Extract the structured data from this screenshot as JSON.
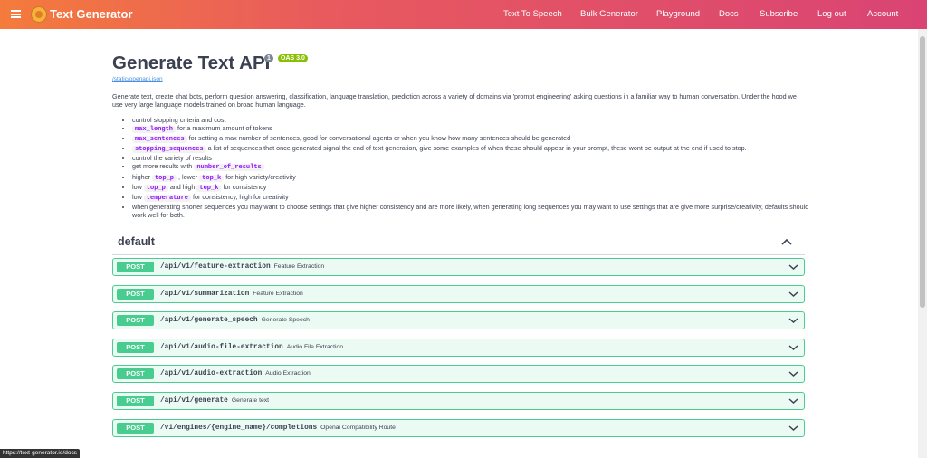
{
  "nav": {
    "brand": "Text Generator",
    "links": [
      "Text To Speech",
      "Bulk Generator",
      "Playground",
      "Docs",
      "Subscribe",
      "Log out",
      "Account"
    ]
  },
  "api": {
    "title": "Generate Text API",
    "version": "1",
    "oas": "OAS 3.0",
    "spec_link": "/static/openapi.json",
    "description": "Generate text, create chat bots, perform question answering, classification, language translation, prediction across a variety of domains via 'prompt engineering' asking questions in a familiar way to human conversation. Under the hood we use very large language models trained on broad human language."
  },
  "features": [
    {
      "pre": "control stopping criteria and cost",
      "code": "",
      "post": ""
    },
    {
      "pre": "",
      "code": "max_length",
      "post": "for a maximum amount of tokens"
    },
    {
      "pre": "",
      "code": "max_sentences",
      "post": "for setting a max number of sentences, good for conversational agents or when you know how many sentences should be generated"
    },
    {
      "pre": "",
      "code": "stopping_sequences",
      "post": "a list of sequences that once generated signal the end of text generation, give some examples of when these should appear in your prompt, these wont be output at the end if used to stop."
    },
    {
      "pre": "control the variety of results",
      "code": "",
      "post": ""
    },
    {
      "pre": "get more results with",
      "code": "number_of_results",
      "post": ""
    },
    {
      "pre": "higher",
      "code": "top_p",
      "post": ", lower",
      "code2": "top_k",
      "post2": "for high variety/creativity"
    },
    {
      "pre": "low",
      "code": "top_p",
      "post": "and high",
      "code2": "top_k",
      "post2": "for consistency"
    },
    {
      "pre": "low",
      "code": "temperature",
      "post": "for consistency, high for creativity"
    },
    {
      "pre": "when generating shorter sequences you may want to choose settings that give higher consistency and are more likely, when generating long sequences you may want to use settings that are give more surprise/creativity, defaults should work well for both.",
      "code": "",
      "post": ""
    }
  ],
  "section": {
    "title": "default"
  },
  "operations": [
    {
      "method": "POST",
      "path": "/api/v1/feature-extraction",
      "summary": "Feature Extraction"
    },
    {
      "method": "POST",
      "path": "/api/v1/summarization",
      "summary": "Feature Extraction"
    },
    {
      "method": "POST",
      "path": "/api/v1/generate_speech",
      "summary": "Generate Speech"
    },
    {
      "method": "POST",
      "path": "/api/v1/audio-file-extraction",
      "summary": "Audio File Extraction"
    },
    {
      "method": "POST",
      "path": "/api/v1/audio-extraction",
      "summary": "Audio Extraction"
    },
    {
      "method": "POST",
      "path": "/api/v1/generate",
      "summary": "Generate text"
    },
    {
      "method": "POST",
      "path": "/v1/engines/{engine_name}/completions",
      "summary": "Openai Compatibility Route"
    }
  ],
  "status_url": "https://text-generator.io/docs",
  "colors": {
    "post_green": "#49cc90",
    "nav_start": "#f47b3c",
    "nav_end": "#d94474",
    "code_purple": "#9012fe"
  },
  "icons": [
    "hamburger-menu-icon",
    "brain-logo-icon",
    "chevron-up-icon",
    "chevron-down-icon"
  ]
}
